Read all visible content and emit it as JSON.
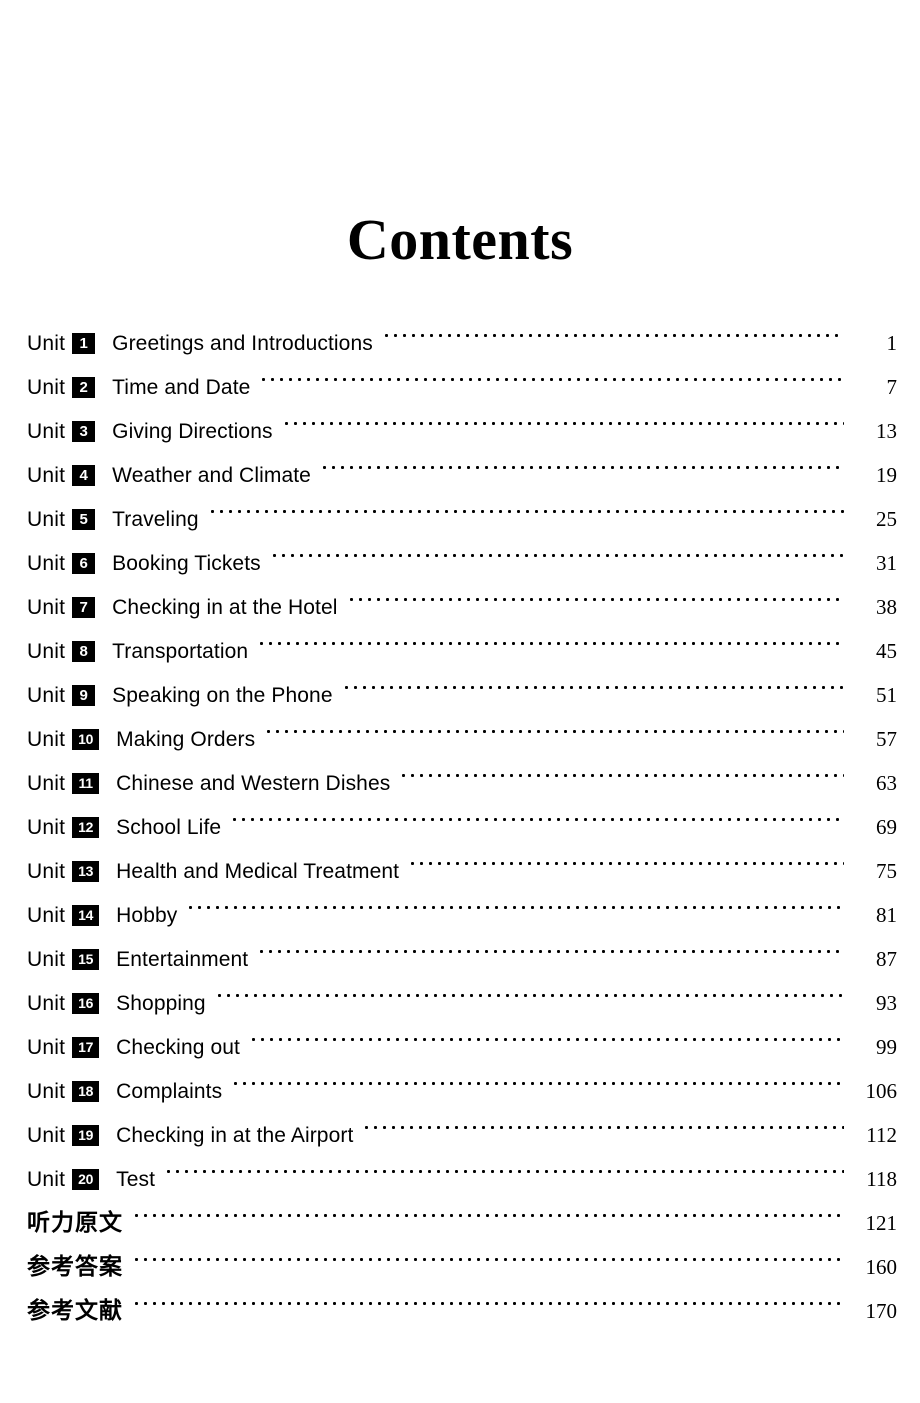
{
  "page": {
    "title": "Contents",
    "unit_word": "Unit"
  },
  "entries": [
    {
      "kind": "unit",
      "unit": "1",
      "title": "Greetings and Introductions",
      "page": "1"
    },
    {
      "kind": "unit",
      "unit": "2",
      "title": "Time and Date",
      "page": "7"
    },
    {
      "kind": "unit",
      "unit": "3",
      "title": "Giving Directions",
      "page": "13"
    },
    {
      "kind": "unit",
      "unit": "4",
      "title": "Weather and Climate",
      "page": "19"
    },
    {
      "kind": "unit",
      "unit": "5",
      "title": "Traveling",
      "page": "25"
    },
    {
      "kind": "unit",
      "unit": "6",
      "title": "Booking Tickets",
      "page": "31"
    },
    {
      "kind": "unit",
      "unit": "7",
      "title": "Checking in at the Hotel",
      "page": "38"
    },
    {
      "kind": "unit",
      "unit": "8",
      "title": "Transportation",
      "page": "45"
    },
    {
      "kind": "unit",
      "unit": "9",
      "title": "Speaking on the Phone",
      "page": "51"
    },
    {
      "kind": "unit",
      "unit": "10",
      "title": "Making Orders",
      "page": "57"
    },
    {
      "kind": "unit",
      "unit": "11",
      "title": "Chinese and Western Dishes",
      "page": "63"
    },
    {
      "kind": "unit",
      "unit": "12",
      "title": "School Life",
      "page": "69"
    },
    {
      "kind": "unit",
      "unit": "13",
      "title": "Health and Medical Treatment",
      "page": "75"
    },
    {
      "kind": "unit",
      "unit": "14",
      "title": "Hobby",
      "page": "81"
    },
    {
      "kind": "unit",
      "unit": "15",
      "title": "Entertainment",
      "page": "87"
    },
    {
      "kind": "unit",
      "unit": "16",
      "title": "Shopping",
      "page": "93"
    },
    {
      "kind": "unit",
      "unit": "17",
      "title": "Checking out",
      "page": "99"
    },
    {
      "kind": "unit",
      "unit": "18",
      "title": "Complaints",
      "page": "106"
    },
    {
      "kind": "unit",
      "unit": "19",
      "title": "Checking in at the Airport",
      "page": "112"
    },
    {
      "kind": "unit",
      "unit": "20",
      "title": "Test",
      "page": "118"
    },
    {
      "kind": "cn",
      "unit": "",
      "title": "听力原文",
      "page": "121"
    },
    {
      "kind": "cn",
      "unit": "",
      "title": "参考答案",
      "page": "160"
    },
    {
      "kind": "cn",
      "unit": "",
      "title": "参考文献",
      "page": "170"
    }
  ],
  "colors": {
    "text": "#000000",
    "background": "#ffffff",
    "badge_background": "#000000",
    "badge_text": "#ffffff"
  }
}
